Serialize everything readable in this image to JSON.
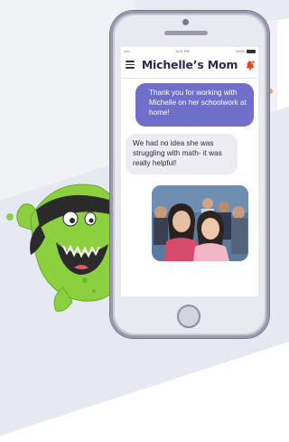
{
  "status_bar": {
    "carrier": "•••••",
    "time": "4:21 PM",
    "battery": "100%"
  },
  "header": {
    "title": "Michelle’s Mom",
    "menu_icon": "hamburger-menu-icon",
    "notification_icon": "bell-icon"
  },
  "messages": [
    {
      "direction": "sent",
      "text": "Thank you for working with Michelle on her schoolwork at home!"
    },
    {
      "direction": "received",
      "text": "We had no idea she was struggling with math- it was really helpful!"
    }
  ],
  "photo": {
    "subject": "two girls at school"
  },
  "colors": {
    "sent_bubble": "#6f6ec9",
    "received_bubble": "#ececf1",
    "title": "#2b2a4c",
    "monster": "#8dd03f",
    "phone_frame": "#c9c9d6"
  }
}
